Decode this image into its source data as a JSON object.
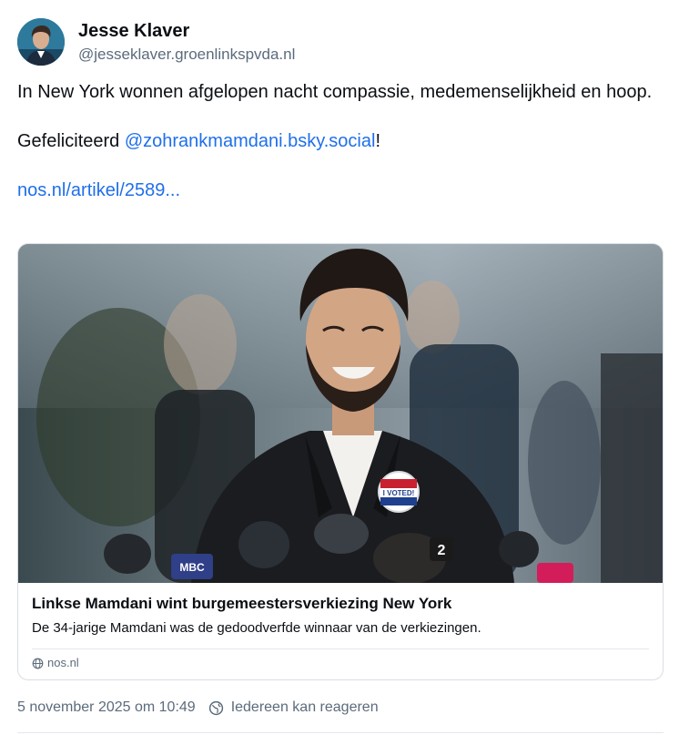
{
  "post": {
    "author": {
      "display_name": "Jesse Klaver",
      "handle": "@jesseklaver.groenlinkspvda.nl"
    },
    "text": {
      "line1": "In New York wonnen afgelopen nacht compassie, medemenselijkheid en hoop.",
      "congrats_prefix": "Gefeliciteerd ",
      "mention": "@zohrankmamdani.bsky.social",
      "congrats_suffix": "!",
      "link": "nos.nl/artikel/2589..."
    },
    "link_card": {
      "title": "Linkse Mamdani wint burgemeestersverkiezing New York",
      "description": "De 34-jarige Mamdani was de gedoodverfde winnaar van de verkiezingen.",
      "domain": "nos.nl",
      "image_text": {
        "badge": "I VOTED!",
        "mic_logo_1": "MBC",
        "mic_logo_2": "2"
      }
    },
    "meta": {
      "timestamp": "5 november 2025 om 10:49",
      "reply_setting": "Iedereen kan reageren"
    }
  },
  "colors": {
    "link": "#1f6feb",
    "secondary_text": "#5b6b7c",
    "border": "#d8dee5"
  }
}
